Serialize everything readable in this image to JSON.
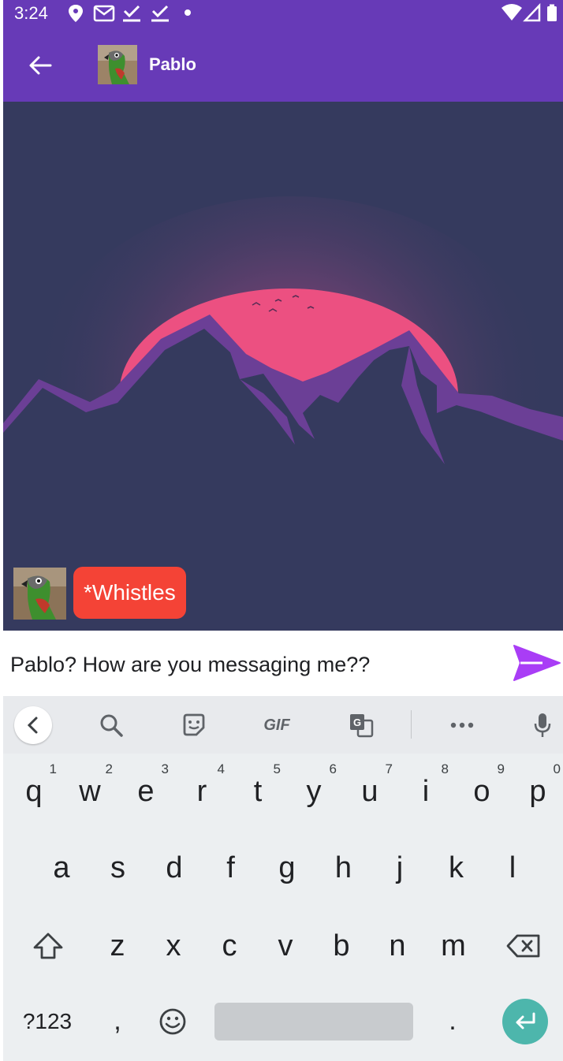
{
  "status_bar": {
    "time": "3:24",
    "icons": [
      "location-icon",
      "gmail-icon",
      "check-icon",
      "check-icon",
      "dot-icon",
      "wifi-icon",
      "signal-icon",
      "battery-icon"
    ]
  },
  "app_bar": {
    "title": "Pablo",
    "back_icon": "arrow-back-icon",
    "color": "#673AB7"
  },
  "chat": {
    "background_color": "#353A5E",
    "messages": [
      {
        "text": "*Whistles",
        "color": "#F44336"
      }
    ]
  },
  "composer": {
    "value": "Pablo? How are you messaging me??",
    "send_icon": "send-icon",
    "send_color": "#A93DF6"
  },
  "keyboard": {
    "toolbar_icons": [
      "chevron-left-icon",
      "search-icon",
      "sticker-icon",
      "gif-icon",
      "translate-icon",
      "more-icon",
      "mic-icon"
    ],
    "gif_label": "GIF",
    "rows": [
      {
        "keys": [
          "q",
          "w",
          "e",
          "r",
          "t",
          "y",
          "u",
          "i",
          "o",
          "p"
        ],
        "hints": [
          "1",
          "2",
          "3",
          "4",
          "5",
          "6",
          "7",
          "8",
          "9",
          "0"
        ]
      },
      {
        "keys": [
          "a",
          "s",
          "d",
          "f",
          "g",
          "h",
          "j",
          "k",
          "l"
        ]
      },
      {
        "keys": [
          "z",
          "x",
          "c",
          "v",
          "b",
          "n",
          "m"
        ]
      }
    ],
    "symbols_label": "?123",
    "comma_label": ",",
    "period_label": ".",
    "enter_color": "#4DB6AC"
  }
}
